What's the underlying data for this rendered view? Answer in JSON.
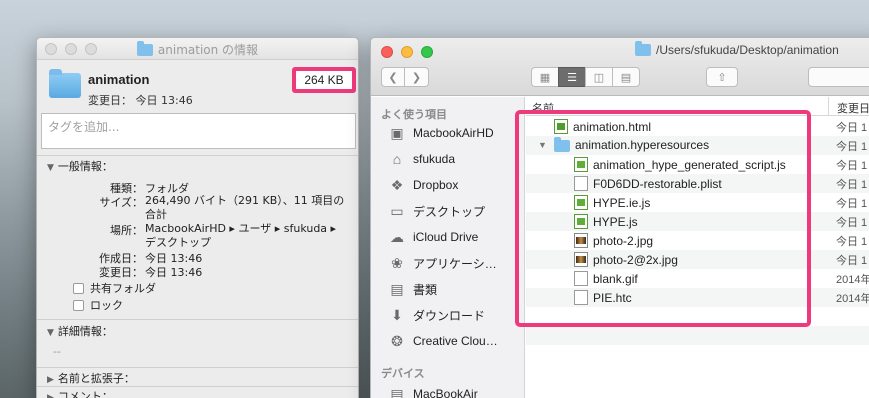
{
  "info": {
    "title": "animation の情報",
    "name": "animation",
    "modified": "変更日： 今日 13:46",
    "size": "264 KB",
    "tag_placeholder": "タグを追加...",
    "general_header": "一般情報：",
    "kind_label": "種類：",
    "kind_value": "フォルダ",
    "size_label": "サイズ：",
    "size_value": "264,490 バイト（291 KB）、11 項目の合計",
    "where_label": "場所：",
    "where_value": "MacbookAirHD ▸ ユーザ ▸ sfukuda ▸ デスクトップ",
    "created_label": "作成日：",
    "created_value": "今日 13:46",
    "mod_label": "変更日：",
    "mod_value": "今日 13:46",
    "shared_label": "共有フォルダ",
    "locked_label": "ロック",
    "details_header": "詳細情報：",
    "details_value": "--",
    "name_ext_header": "名前と拡張子：",
    "comments_header": "コメント："
  },
  "finder": {
    "path": "/Users/sfukuda/Desktop/animation",
    "sidebar_favorites": "よく使う項目",
    "sidebar_items": [
      {
        "label": "MacbookAirHD",
        "icon": "hard-drive-icon"
      },
      {
        "label": "sfukuda",
        "icon": "home-icon"
      },
      {
        "label": "Dropbox",
        "icon": "dropbox-icon"
      },
      {
        "label": "デスクトップ",
        "icon": "desktop-icon"
      },
      {
        "label": "iCloud Drive",
        "icon": "cloud-icon"
      },
      {
        "label": "アプリケーシ…",
        "icon": "applications-icon"
      },
      {
        "label": "書類",
        "icon": "documents-icon"
      },
      {
        "label": "ダウンロード",
        "icon": "download-icon"
      },
      {
        "label": "Creative Clou…",
        "icon": "creative-cloud-icon"
      }
    ],
    "sidebar_devices": "デバイス",
    "sidebar_device_item": "MacBookAir",
    "col_name": "名前",
    "col_date": "変更日",
    "rows": [
      {
        "name": "animation.html",
        "date": "今日 1",
        "icon": "html-file-icon"
      },
      {
        "name": "animation.hyperesources",
        "date": "今日 1",
        "icon": "folder-icon"
      },
      {
        "name": "animation_hype_generated_script.js",
        "date": "今日 1",
        "icon": "js-file-icon"
      },
      {
        "name": "F0D6DD-restorable.plist",
        "date": "今日 1",
        "icon": "plist-file-icon"
      },
      {
        "name": "HYPE.ie.js",
        "date": "今日 1",
        "icon": "js-file-icon"
      },
      {
        "name": "HYPE.js",
        "date": "今日 1",
        "icon": "js-file-icon"
      },
      {
        "name": "photo-2.jpg",
        "date": "今日 1",
        "icon": "image-file-icon"
      },
      {
        "name": "photo-2@2x.jpg",
        "date": "今日 1",
        "icon": "image-file-icon"
      },
      {
        "name": "blank.gif",
        "date": "2014年",
        "icon": "gif-file-icon"
      },
      {
        "name": "PIE.htc",
        "date": "2014年",
        "icon": "htc-file-icon"
      }
    ]
  },
  "colors": {
    "highlight": "#ee3a7c",
    "folder": "#7fc0ec"
  }
}
